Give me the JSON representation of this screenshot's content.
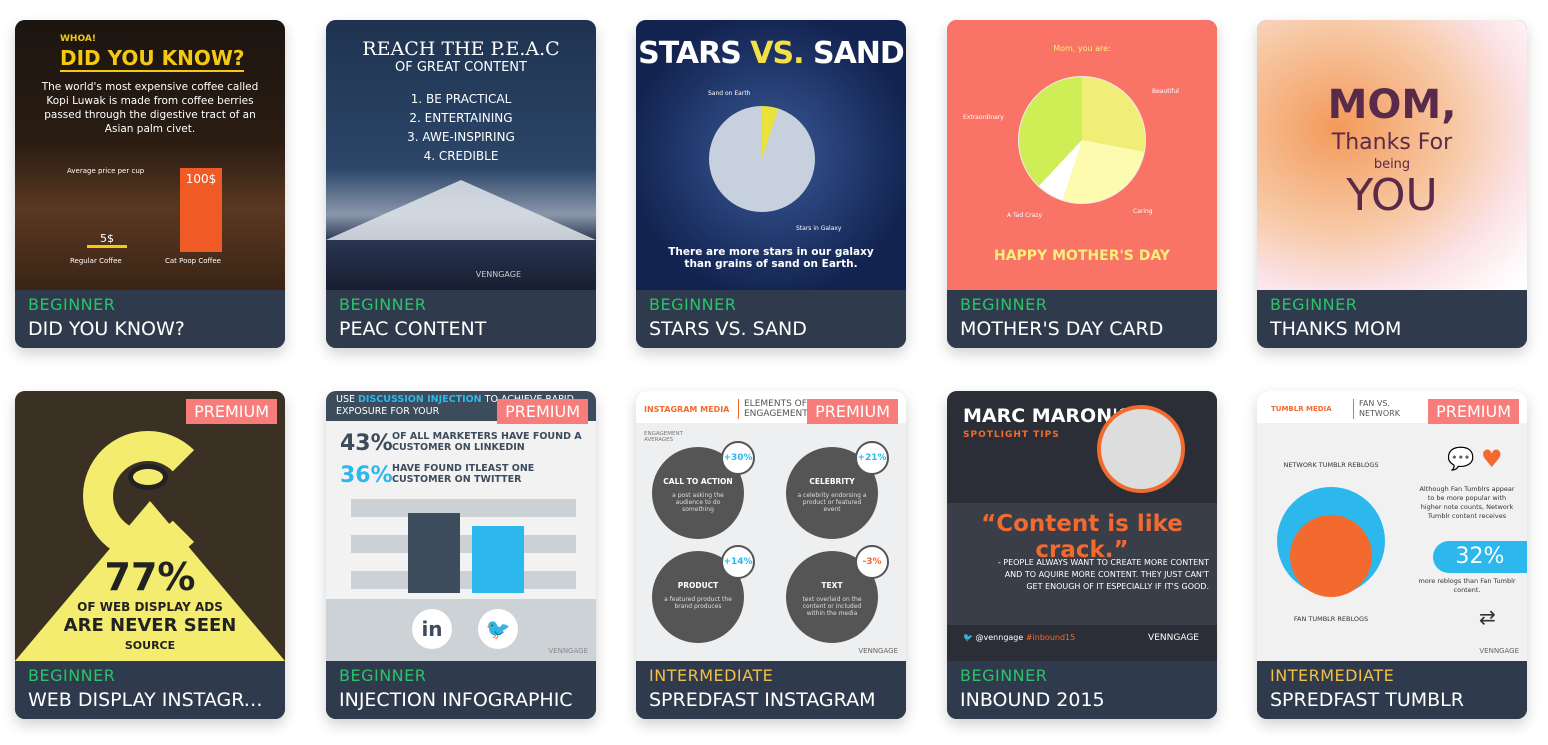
{
  "colors": {
    "footer": "#2f3b4c",
    "beginner": "#29c46a",
    "intermediate": "#f2c046",
    "premium": "#f77c7a"
  },
  "premium_label": "PREMIUM",
  "cards": [
    {
      "level": "BEGINNER",
      "title": "DID YOU KNOW?",
      "thumb": {
        "kicker": "WHOA!",
        "heading": "DID YOU KNOW?",
        "body": "The world's most expensive coffee called Kopi Luwak is made from coffee berries passed through the digestive tract of an Asian palm civet.",
        "caption": "Average price per cup",
        "v1": "5$",
        "v2": "100$",
        "l1": "Regular Coffee",
        "l2": "Cat Poop Coffee"
      }
    },
    {
      "level": "BEGINNER",
      "title": "PEAC CONTENT",
      "thumb": {
        "heading": "REACH THE P.E.A.C",
        "sub": "OF GREAT CONTENT",
        "items": [
          "1. BE PRACTICAL",
          "2. ENTERTAINING",
          "3. AWE-INSPIRING",
          "4. CREDIBLE"
        ],
        "brand": "VENNGAGE"
      }
    },
    {
      "level": "BEGINNER",
      "title": "STARS VS. SAND",
      "thumb": {
        "h1": "STARS",
        "h2": "VS.",
        "h3": "SAND",
        "l1": "Sand on Earth",
        "l2": "Stars in Galaxy",
        "body": "There are more stars in our galaxy than grains of sand on Earth."
      }
    },
    {
      "level": "BEGINNER",
      "title": "MOTHER'S DAY CARD",
      "thumb": {
        "heading": "Mom, you are:",
        "labels": [
          "Beautiful",
          "Extraordinary",
          "A Tad Crazy",
          "Caring"
        ],
        "footer": "HAPPY MOTHER'S DAY"
      }
    },
    {
      "level": "BEGINNER",
      "title": "THANKS MOM",
      "thumb": {
        "l1": "MOM,",
        "l2": "Thanks For",
        "l3": "being",
        "l4": "YOU"
      }
    },
    {
      "level": "BEGINNER",
      "title": "WEB DISPLAY INSTAGRAM",
      "premium": true,
      "thumb": {
        "big": "77%",
        "l1": "OF WEB DISPLAY ADS",
        "l2": "ARE NEVER SEEN",
        "l3": "SOURCE"
      }
    },
    {
      "level": "BEGINNER",
      "title": "INJECTION INFOGRAPHIC",
      "premium": true,
      "thumb": {
        "h_pre": "USE",
        "h_hl": "DISCUSSION INJECTION",
        "h_post": "TO ACHIEVE RAPID EXPOSURE FOR YOUR",
        "s1": "43%",
        "t1": "OF ALL MARKETERS HAVE FOUND A CUSTOMER ON LINKEDIN",
        "s2": "36%",
        "t2": "HAVE FOUND ITLEAST ONE CUSTOMER ON TWITTER",
        "brand": "VENNGAGE"
      }
    },
    {
      "level": "INTERMEDIATE",
      "title": "SPREDFAST INSTAGRAM",
      "premium": true,
      "thumb": {
        "tag": "INSTAGRAM MEDIA",
        "heading": "ELEMENTS OF ENGAGEMENT",
        "sub": "ENGAGEMENT AVERAGES",
        "items": [
          {
            "name": "CALL TO ACTION",
            "pct": "+30%",
            "desc": "a post asking the audience to do something"
          },
          {
            "name": "CELEBRITY",
            "pct": "+21%",
            "desc": "a celebrity endorsing a product or featured event"
          },
          {
            "name": "PRODUCT",
            "pct": "+14%",
            "desc": "a featured product the brand produces"
          },
          {
            "name": "TEXT",
            "pct": "-3%",
            "desc": "text overlaid on the content or included within the media"
          }
        ],
        "brand": "VENNGAGE"
      }
    },
    {
      "level": "BEGINNER",
      "title": "INBOUND 2015",
      "thumb": {
        "heading": "MARC MARON'S",
        "sub": "SPOTLIGHT TIPS",
        "quote": "“Content is like crack.”",
        "body": "- PEOPLE ALWAYS WANT TO CREATE MORE CONTENT AND TO AQUIRE MORE CONTENT. THEY JUST CAN'T GET ENOUGH OF IT ESPECIALLY IF IT'S GOOD.",
        "handle": "@venngage",
        "tag": "#inbound15",
        "brand": "VENNGAGE"
      }
    },
    {
      "level": "INTERMEDIATE",
      "title": "SPREDFAST TUMBLR",
      "premium": true,
      "thumb": {
        "tag": "TUMBLR MEDIA",
        "heading": "FAN VS. NETWORK",
        "l1": "NETWORK TUMBLR REBLOGS",
        "l2": "FAN TUMBLR REBLOGS",
        "body": "Although Fan Tumblrs appear to be more popular with higher note counts, Network Tumblr content receives",
        "pct": "32%",
        "body2": "more reblogs than Fan Tumblr content.",
        "brand": "VENNGAGE"
      }
    }
  ]
}
